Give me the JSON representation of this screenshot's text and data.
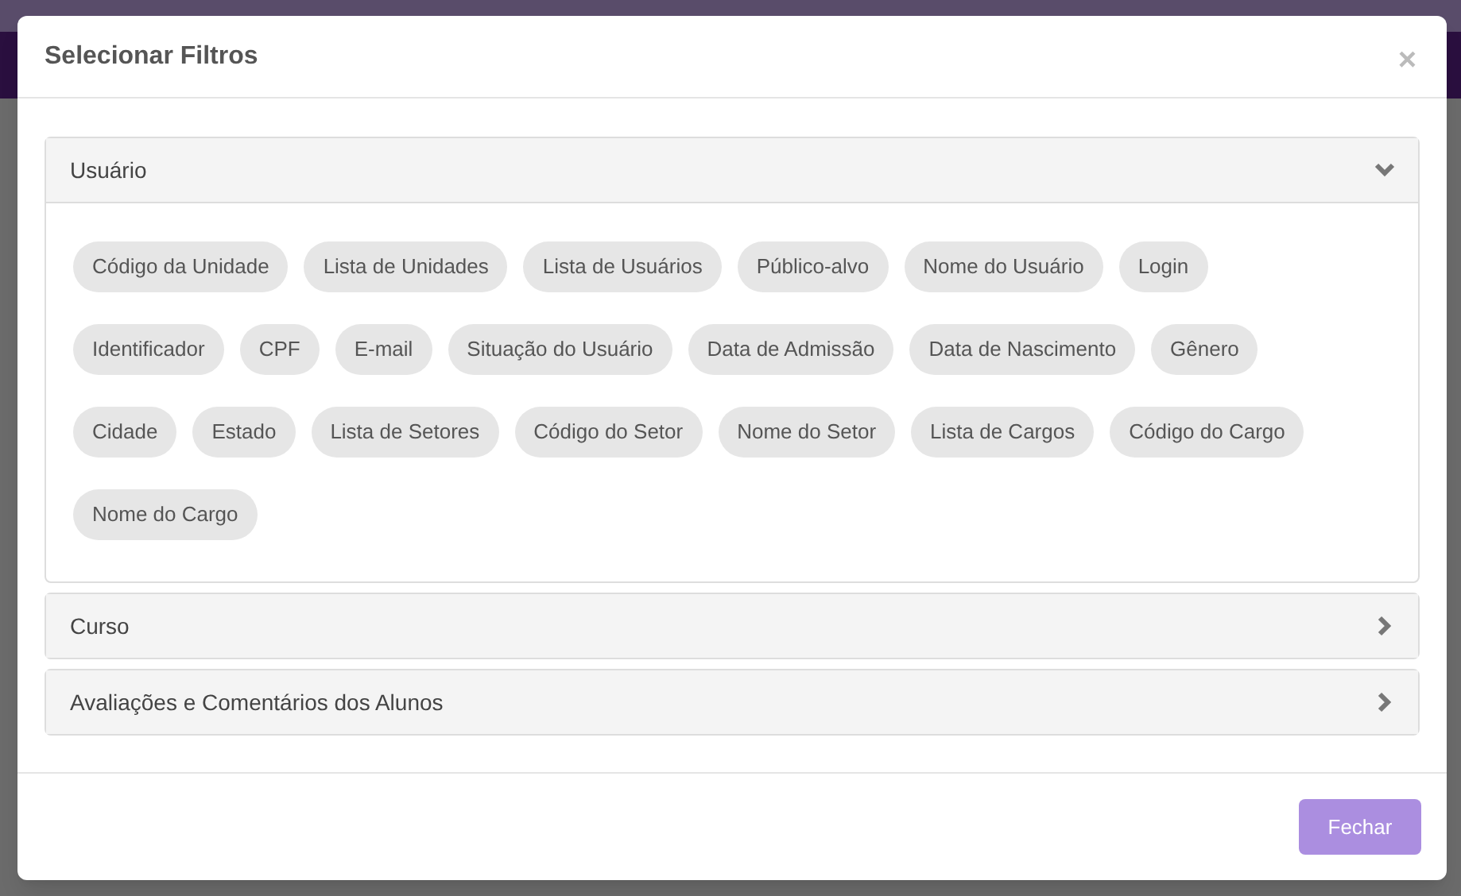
{
  "dialog": {
    "title": "Selecionar Filtros",
    "close": "×"
  },
  "panels": [
    {
      "title": "Usuário",
      "expanded": true,
      "chips": [
        "Código da Unidade",
        "Lista de Unidades",
        "Lista de Usuários",
        "Público-alvo",
        "Nome do Usuário",
        "Login",
        "Identificador",
        "CPF",
        "E-mail",
        "Situação do Usuário",
        "Data de Admissão",
        "Data de Nascimento",
        "Gênero",
        "Cidade",
        "Estado",
        "Lista de Setores",
        "Código do Setor",
        "Nome do Setor",
        "Lista de Cargos",
        "Código do Cargo",
        "Nome do Cargo"
      ]
    },
    {
      "title": "Curso",
      "expanded": false
    },
    {
      "title": "Avaliações e Comentários dos Alunos",
      "expanded": false
    }
  ],
  "footer": {
    "button": "Fechar"
  }
}
